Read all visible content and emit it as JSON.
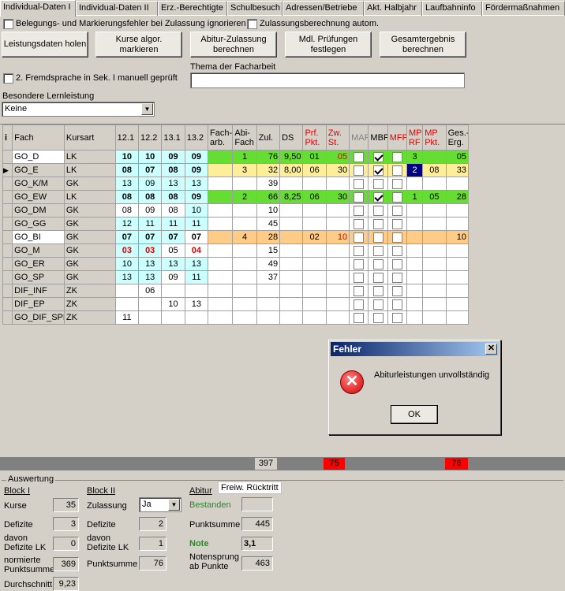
{
  "tabs": [
    "Individual-Daten I",
    "Individual-Daten II",
    "Erz.-Berechtigte",
    "Schulbesuch",
    "Adressen/Betriebe",
    "Akt. Halbjahr",
    "Laufbahninfo",
    "Fördermaßnahmen"
  ],
  "options": {
    "ignore_errors_label": "Belegungs- und Markierungsfehler bei Zulassung ignorieren",
    "auto_calc_label": "Zulassungsberechnung autom.",
    "second_language_label": "2. Fremdsprache in Sek. I manuell geprüft"
  },
  "buttons": {
    "fetch": "Leistungsdaten holen",
    "mark": "Kurse algor.\nmarkieren",
    "abitur_calc": "Abitur-Zulassung\nberechnen",
    "oral": "Mdl. Prüfungen\nfestlegen",
    "total": "Gesamtergebnis\nberechnen"
  },
  "thesis": {
    "label": "Thema der Facharbeit",
    "value": ""
  },
  "special": {
    "label": "Besondere Lernleistung",
    "value": "Keine"
  },
  "grid": {
    "headers": [
      "i",
      "Fach",
      "Kursart",
      "12.1",
      "12.2",
      "13.1",
      "13.2",
      "Fach-\narb.",
      "Abi-\nFach",
      "Zul.",
      "DS",
      "Prf.\nPkt.",
      "Zw.\nSt.",
      "MAP",
      "MBP",
      "MFP",
      "MP\nRF",
      "MP\nPkt.",
      "Ges.-\nErg."
    ],
    "rows": [
      {
        "fach": "GO_D",
        "kurs": "LK",
        "h": [
          "10",
          "10",
          "09",
          "09"
        ],
        "fa": "",
        "abi": "1",
        "zul": "76",
        "ds": "9,50",
        "prf": "01",
        "zw": "05",
        "map": false,
        "mbp": true,
        "mfp": false,
        "rf": "3",
        "mp": "",
        "ges": "05"
      },
      {
        "fach": "GO_E",
        "kurs": "LK",
        "h": [
          "08",
          "07",
          "08",
          "09"
        ],
        "fa": "",
        "abi": "3",
        "zul": "32",
        "ds": "8,00",
        "prf": "06",
        "zw": "30",
        "map": false,
        "mbp": true,
        "mfp": false,
        "rf": "2",
        "mp": "08",
        "ges": "33"
      },
      {
        "fach": "GO_K/M",
        "kurs": "GK",
        "h": [
          "13",
          "09",
          "13",
          "13"
        ],
        "fa": "",
        "abi": "",
        "zul": "39",
        "ds": "",
        "prf": "",
        "zw": "",
        "map": false,
        "mbp": false,
        "mfp": false,
        "rf": "",
        "mp": "",
        "ges": ""
      },
      {
        "fach": "GO_EW",
        "kurs": "LK",
        "h": [
          "08",
          "08",
          "08",
          "09"
        ],
        "fa": "",
        "abi": "2",
        "zul": "66",
        "ds": "8,25",
        "prf": "06",
        "zw": "30",
        "map": false,
        "mbp": true,
        "mfp": false,
        "rf": "1",
        "mp": "05",
        "ges": "28"
      },
      {
        "fach": "GO_DM",
        "kurs": "GK",
        "h": [
          "08",
          "09",
          "08",
          "10"
        ],
        "fa": "",
        "abi": "",
        "zul": "10",
        "ds": "",
        "prf": "",
        "zw": "",
        "map": false,
        "mbp": false,
        "mfp": false,
        "rf": "",
        "mp": "",
        "ges": ""
      },
      {
        "fach": "GO_GG",
        "kurs": "GK",
        "h": [
          "12",
          "11",
          "11",
          "11"
        ],
        "fa": "",
        "abi": "",
        "zul": "45",
        "ds": "",
        "prf": "",
        "zw": "",
        "map": false,
        "mbp": false,
        "mfp": false,
        "rf": "",
        "mp": "",
        "ges": ""
      },
      {
        "fach": "GO_BI",
        "kurs": "GK",
        "h": [
          "07",
          "07",
          "07",
          "07"
        ],
        "fa": "",
        "abi": "4",
        "zul": "28",
        "ds": "",
        "prf": "02",
        "zw": "10",
        "map": false,
        "mbp": false,
        "mfp": false,
        "rf": "",
        "mp": "",
        "ges": "10"
      },
      {
        "fach": "GO_M",
        "kurs": "GK",
        "h": [
          "03",
          "03",
          "05",
          "04"
        ],
        "fa": "",
        "abi": "",
        "zul": "15",
        "ds": "",
        "prf": "",
        "zw": "",
        "map": false,
        "mbp": false,
        "mfp": false,
        "rf": "",
        "mp": "",
        "ges": ""
      },
      {
        "fach": "GO_ER",
        "kurs": "GK",
        "h": [
          "10",
          "13",
          "13",
          "13"
        ],
        "fa": "",
        "abi": "",
        "zul": "49",
        "ds": "",
        "prf": "",
        "zw": "",
        "map": false,
        "mbp": false,
        "mfp": false,
        "rf": "",
        "mp": "",
        "ges": ""
      },
      {
        "fach": "GO_SP",
        "kurs": "GK",
        "h": [
          "13",
          "13",
          "09",
          "11"
        ],
        "fa": "",
        "abi": "",
        "zul": "37",
        "ds": "",
        "prf": "",
        "zw": "",
        "map": false,
        "mbp": false,
        "mfp": false,
        "rf": "",
        "mp": "",
        "ges": ""
      },
      {
        "fach": "DIF_INF",
        "kurs": "ZK",
        "h": [
          "",
          "06",
          "",
          ""
        ],
        "fa": "",
        "abi": "",
        "zul": "",
        "ds": "",
        "prf": "",
        "zw": "",
        "map": false,
        "mbp": false,
        "mfp": false,
        "rf": "",
        "mp": "",
        "ges": ""
      },
      {
        "fach": "DIF_EP",
        "kurs": "ZK",
        "h": [
          "",
          "",
          "10",
          "13"
        ],
        "fa": "",
        "abi": "",
        "zul": "",
        "ds": "",
        "prf": "",
        "zw": "",
        "map": false,
        "mbp": false,
        "mfp": false,
        "rf": "",
        "mp": "",
        "ges": ""
      },
      {
        "fach": "GO_DIF_SPE",
        "kurs": "ZK",
        "h": [
          "11",
          "",
          "",
          ""
        ],
        "fa": "",
        "abi": "",
        "zul": "",
        "ds": "",
        "prf": "",
        "zw": "",
        "map": false,
        "mbp": false,
        "mfp": false,
        "rf": "",
        "mp": "",
        "ges": ""
      }
    ],
    "totals": {
      "zul": "397",
      "zw": "75",
      "ges": "76"
    }
  },
  "dialog": {
    "title": "Fehler",
    "message": "Abiturleistungen unvollständig",
    "ok": "OK",
    "close": "✕"
  },
  "auswertung": {
    "title": "Auswertung",
    "block1": {
      "title": "Block I",
      "kurse_label": "Kurse",
      "kurse": "35",
      "defizite_label": "Defizite",
      "defizite": "3",
      "lk_label": "davon\nDefizite LK",
      "lk": "0",
      "norm_label": "normierte\nPunktsumme",
      "norm": "369",
      "schnitt_label": "Durchschnitt",
      "schnitt": "9,23"
    },
    "block2": {
      "title": "Block II",
      "zul_label": "Zulassung",
      "zul": "Ja",
      "defizite_label": "Defizite",
      "defizite": "2",
      "lk_label": "davon\nDefizite LK",
      "lk": "1",
      "sum_label": "Punktsumme",
      "sum": "76"
    },
    "abitur": {
      "title": "Abitur",
      "ruecktritt": "Freiw. Rücktritt",
      "bestanden": "Bestanden",
      "sum_label": "Punktsumme",
      "sum": "445",
      "note_label": "Note",
      "note": "3,1",
      "sprung_label": "Notensprung\nab Punkte",
      "sprung": "463"
    }
  }
}
